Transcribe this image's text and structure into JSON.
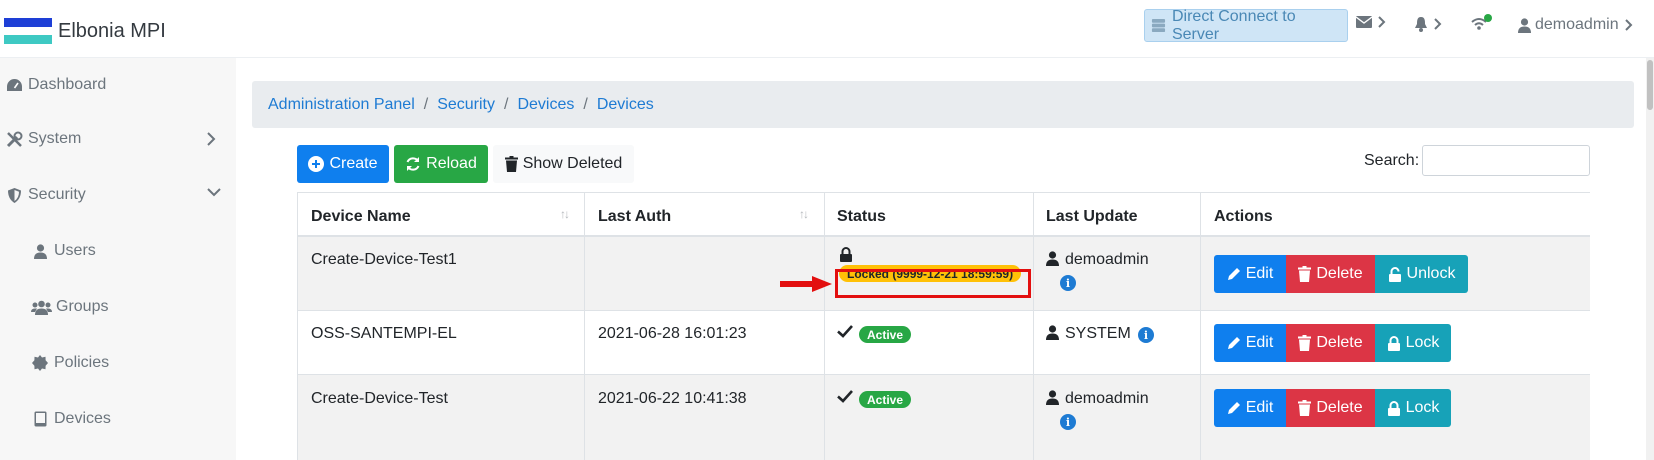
{
  "app": {
    "title": "Elbonia MPI",
    "flag_colors": [
      "#1e3fd6",
      "#ffffff",
      "#3ec9c3"
    ]
  },
  "topbar": {
    "direct_connect_label": "Direct Connect to Server",
    "user_label": "demoadmin",
    "status_dot_color": "#28a745"
  },
  "sidebar": {
    "items": [
      {
        "label": "Dashboard",
        "icon": "tachometer-icon"
      },
      {
        "label": "System",
        "icon": "tools-icon"
      },
      {
        "label": "Security",
        "icon": "shield-icon"
      },
      {
        "label": "Users",
        "icon": "user-icon"
      },
      {
        "label": "Groups",
        "icon": "users-icon"
      },
      {
        "label": "Policies",
        "icon": "certificate-icon"
      },
      {
        "label": "Devices",
        "icon": "tablet-icon"
      }
    ]
  },
  "breadcrumb": {
    "items": [
      "Administration Panel",
      "Security",
      "Devices",
      "Devices"
    ]
  },
  "toolbar": {
    "create_label": "Create",
    "reload_label": "Reload",
    "show_deleted_label": "Show Deleted",
    "search_label": "Search:",
    "search_value": ""
  },
  "table": {
    "headers": [
      "Device Name",
      "Last Auth",
      "Status",
      "Last Update",
      "Actions"
    ],
    "rows": [
      {
        "device_name": "Create-Device-Test1",
        "last_auth": "",
        "status": "Locked (9999-12-21 18:59:59)",
        "status_type": "locked",
        "last_update": "demoadmin",
        "lock_action": "Unlock"
      },
      {
        "device_name": "OSS-SANTEMPI-EL",
        "last_auth": "2021-06-28 16:01:23",
        "status": "Active",
        "status_type": "active",
        "last_update": "SYSTEM",
        "lock_action": "Lock"
      },
      {
        "device_name": "Create-Device-Test",
        "last_auth": "2021-06-22 10:41:38",
        "status": "Active",
        "status_type": "active",
        "last_update": "demoadmin",
        "lock_action": "Lock"
      }
    ],
    "edit_label": "Edit",
    "delete_label": "Delete",
    "info_glyph": "i"
  },
  "colors": {
    "primary": "#0f7fee",
    "success": "#28a745",
    "danger": "#dc3545",
    "info": "#17a2b8",
    "warning": "#ffc107",
    "annotation": "#e30f0f"
  }
}
